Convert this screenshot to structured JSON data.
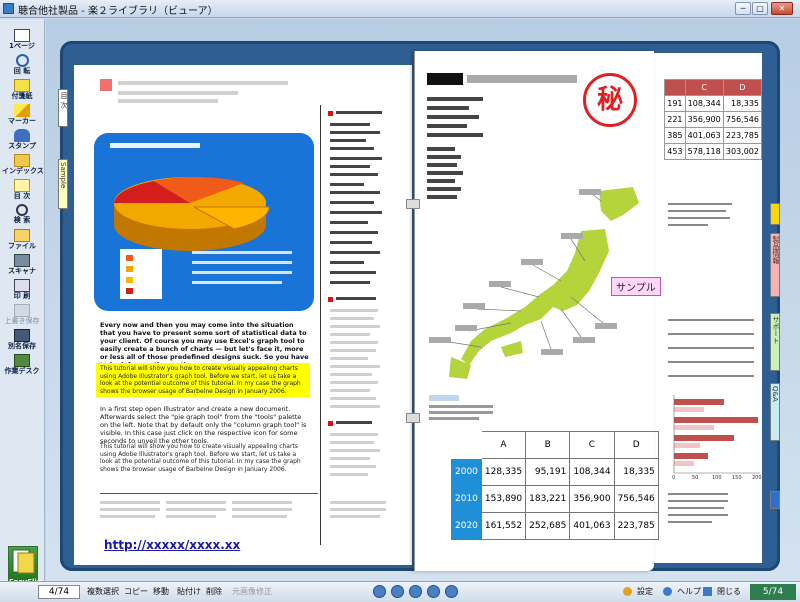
{
  "window": {
    "title": "聴合他社製品 - 楽２ライブラリ（ビューア）",
    "minimize": "─",
    "maximize": "□",
    "close": "✕"
  },
  "toolbar": {
    "items": [
      {
        "label": "1ページ",
        "icon": "single-page-icon"
      },
      {
        "label": "回 転",
        "icon": "rotate-icon"
      },
      {
        "label": "付箋紙",
        "icon": "sticky-note-icon"
      },
      {
        "label": "マーカー",
        "icon": "marker-icon"
      },
      {
        "label": "スタンプ",
        "icon": "stamp-icon"
      },
      {
        "label": "インデックス",
        "icon": "index-icon"
      },
      {
        "label": "目 次",
        "icon": "table-of-contents-icon"
      },
      {
        "label": "検 索",
        "icon": "search-icon"
      },
      {
        "label": "ファイル",
        "icon": "file-icon"
      },
      {
        "label": "スキャナ",
        "icon": "scanner-icon"
      },
      {
        "label": "印 刷",
        "icon": "print-icon"
      },
      {
        "label": "上書き保存",
        "icon": "save-icon"
      },
      {
        "label": "別名保存",
        "icon": "save-as-icon"
      },
      {
        "label": "作業デスク",
        "icon": "desk-icon"
      }
    ],
    "logo": "EasyFlip"
  },
  "book": {
    "left_index_tabs": [
      "目 次",
      "Sample"
    ],
    "right_index_tabs": [
      "製品情報",
      "サポート",
      "Q&A"
    ],
    "left_page": {
      "para1": "Every now and then you may come into the situation that you have to present some sort of statistical data to your client. Of course you may use Excel's graph tool to easily create a bunch of charts — but let's face it, more or less all of those predefined designs suck. So you have to look for another option.",
      "highlight": "This tutorial will show you how to create visually appealing charts using Adobe Illustrator's graph tool. Before we start, let us take a look at the potential outcome of this tutorial. In my case the graph shows the browser usage of Barbelne Design in January 2006.",
      "para2": "In a first step open Illustrator and create a new document. Afterwards select the \"pie graph tool\" from the \"tools\" palette on the left. Note that by default only the \"column graph tool\" is visible. In this case just click on the respective icon for some seconds to unveil the other tools.",
      "para3": "This tutorial will show you how to create visually appealing charts using Adobe Illustrator's graph tool. Before we start, let us take a look at the potential outcome of this tutorial. In my case the graph shows the browser usage of Barbelne Design in January 2006.",
      "url": "http://xxxxx/xxxx.xx"
    },
    "flip_page": {
      "stamp": "秘",
      "callout": "サンプル",
      "table": {
        "headers": [
          "",
          "A",
          "B",
          "C",
          "D"
        ],
        "rows": [
          {
            "year": "2000",
            "values": [
              "128,335",
              "95,191",
              "108,344",
              "18,335"
            ]
          },
          {
            "year": "2010",
            "values": [
              "153,890",
              "183,221",
              "356,900",
              "756,546"
            ]
          },
          {
            "year": "2020",
            "values": [
              "161,552",
              "252,685",
              "401,063",
              "223,785"
            ]
          }
        ]
      }
    },
    "right_page": {
      "table": {
        "headers": [
          "C",
          "D"
        ],
        "rows": [
          [
            "191",
            "108,344",
            "18,335"
          ],
          [
            "221",
            "356,900",
            "756,546"
          ],
          [
            "385",
            "401,063",
            "223,785"
          ],
          [
            "453",
            "578,118",
            "303,002"
          ]
        ]
      },
      "axis_ticks": [
        "0",
        "50",
        "100",
        "150",
        "200"
      ]
    }
  },
  "statusbar": {
    "page_input": "4/74",
    "buttons": [
      "複数選択",
      "コピー",
      "移動",
      "貼付け",
      "削除"
    ],
    "disabled_button": "元画像修正",
    "settings": "設定",
    "help": "ヘルプ",
    "close": "閉じる",
    "page_indicator": "5/74"
  },
  "colors": {
    "book_cover": "#2f5f92",
    "highlight": "#ffff00",
    "map_green": "#b5d33a",
    "table_header_blue": "#1f8fd8",
    "stamp_red": "#e02020"
  }
}
